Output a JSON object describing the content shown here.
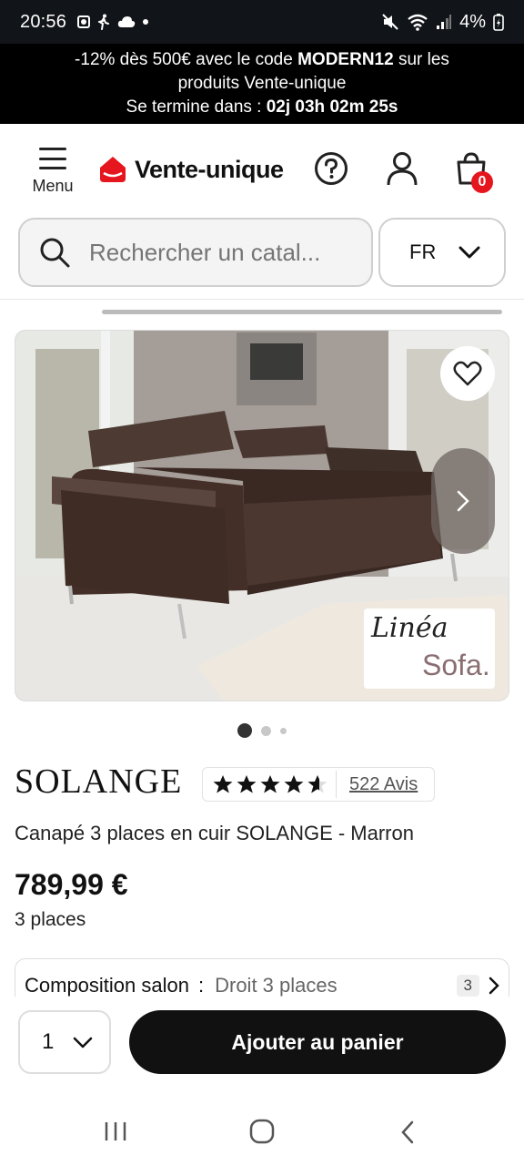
{
  "status_bar": {
    "time": "20:56",
    "battery": "4%"
  },
  "promo": {
    "line1_pre": "-12% dès 500€ avec le code ",
    "code": "MODERN12",
    "line1_post": " sur les",
    "line2": "produits Vente-unique",
    "line3_pre": "Se termine dans : ",
    "countdown": "02j 03h 02m 25s"
  },
  "header": {
    "menu_label": "Menu",
    "logo_text": "Vente-unique",
    "cart_count": "0"
  },
  "search": {
    "placeholder": "Rechercher un catal..."
  },
  "language": {
    "selected": "FR"
  },
  "image": {
    "brand_script": "Linéa",
    "brand_name": "Sofa."
  },
  "carousel": {
    "total": 3,
    "active": 1
  },
  "product": {
    "name": "SOLANGE",
    "rating": 4.6,
    "reviews_label": "522 Avis",
    "subtitle": "Canapé 3 places en cuir SOLANGE - Marron",
    "price": "789,99 €",
    "places": "3 places"
  },
  "composition": {
    "label": "Composition salon",
    "separator": ":",
    "value": "Droit 3 places",
    "count": "3"
  },
  "cart_bar": {
    "quantity": "1",
    "add_label": "Ajouter au panier"
  },
  "colors": {
    "logo_red": "#e5161d",
    "badge_red": "#e5161d",
    "promo_bg": "#000000",
    "button_bg": "#111111"
  }
}
